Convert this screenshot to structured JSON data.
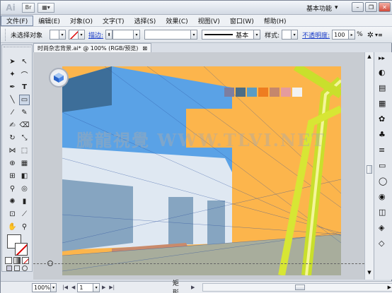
{
  "app": {
    "logo": "Ai",
    "workspace": "基本功能"
  },
  "menu": [
    "文件(F)",
    "编辑(E)",
    "对象(O)",
    "文字(T)",
    "选择(S)",
    "效果(C)",
    "视图(V)",
    "窗口(W)",
    "帮助(H)"
  ],
  "control": {
    "selection": "未选择对象",
    "stroke_label": "描边:",
    "stroke_style": "基本",
    "style_label": "样式:",
    "opacity_label": "不透明度:",
    "opacity_value": "100",
    "percent": "%"
  },
  "document": {
    "tab_title": "时尚杂志背景.ai* @ 100% (RGB/预览)",
    "close": "⊠"
  },
  "status": {
    "zoom": "100%",
    "page": "1",
    "tool": "矩形"
  },
  "watermark": "騰龍視覺 WWW.TLVI.NET",
  "swatches": [
    "#7d7ea0",
    "#4c6d85",
    "#5a9cc4",
    "#ee7d20",
    "#c5876c",
    "#e59b9d",
    "#f2f2f2"
  ],
  "colors": {
    "artboard": "#fcb54c",
    "building": "#5a9fe0",
    "accent": "#c9df2c"
  }
}
